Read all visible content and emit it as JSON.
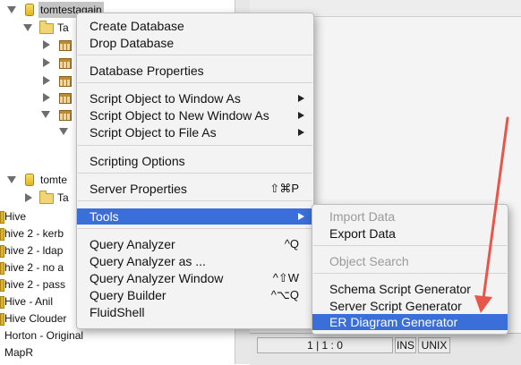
{
  "tree": {
    "db1_name": "tomtestagain",
    "db1_folder": "Ta",
    "db2_name": "tomte",
    "db2_folder": "Ta",
    "datasources": [
      "Hive",
      "hive 2 - kerb",
      "hive 2 - ldap",
      "hive 2 - no a",
      "hive 2 - pass",
      "Hive - Anil",
      "Hive Clouder",
      "Horton - Original",
      "MapR"
    ]
  },
  "context_menu": {
    "items": [
      {
        "label": "Create Database"
      },
      {
        "label": "Drop Database"
      },
      {
        "label": "Database Properties"
      },
      {
        "label": "Script Object to Window As"
      },
      {
        "label": "Script Object to New Window As"
      },
      {
        "label": "Script Object to File As"
      },
      {
        "label": "Scripting Options"
      },
      {
        "label": "Server Properties",
        "shortcut": "⇧⌘P"
      },
      {
        "label": "Tools"
      },
      {
        "label": "Query Analyzer",
        "shortcut": "^Q"
      },
      {
        "label": "Query Analyzer as ..."
      },
      {
        "label": "Query Analyzer Window",
        "shortcut": "^⇧W"
      },
      {
        "label": "Query Builder",
        "shortcut": "^⌥Q"
      },
      {
        "label": "FluidShell"
      }
    ]
  },
  "tools_submenu": {
    "items": [
      {
        "label": "Import Data"
      },
      {
        "label": "Export Data"
      },
      {
        "label": "Object Search"
      },
      {
        "label": "Schema Script Generator"
      },
      {
        "label": "Server Script Generator"
      },
      {
        "label": "ER Diagram Generator"
      }
    ]
  },
  "status_bar": {
    "position": "1 | 1 : 0",
    "mode": "INS",
    "line_endings": "UNIX"
  },
  "colors": {
    "highlight": "#3a6ed8",
    "annotation_arrow": "#e8564a"
  }
}
